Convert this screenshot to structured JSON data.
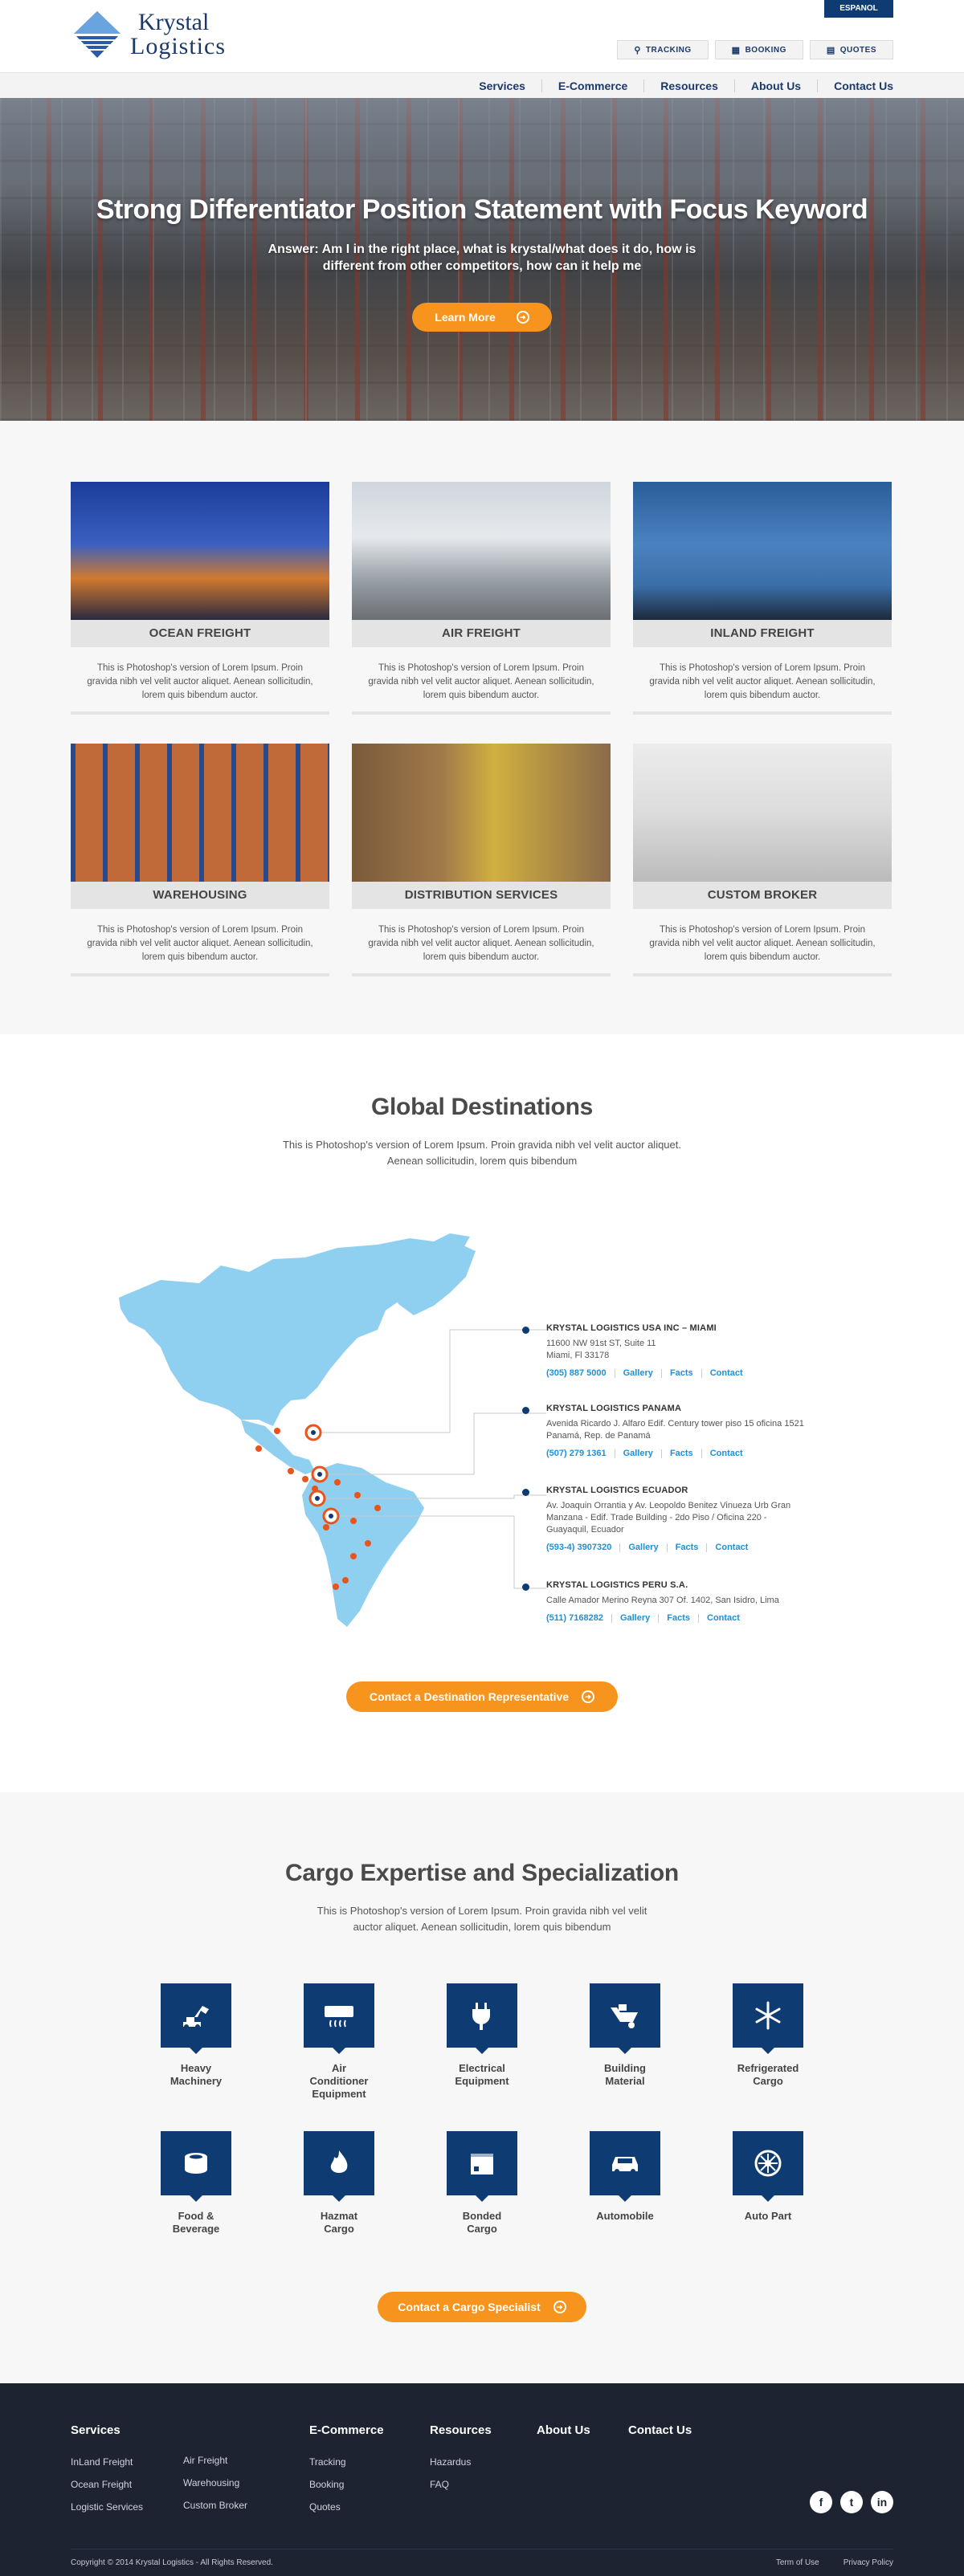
{
  "header": {
    "logo_line1": "Krystal",
    "logo_line2": "Logistics",
    "language_button": "ESPANOL",
    "utility_links": [
      {
        "label": "TRACKING",
        "icon": "map-pin-icon"
      },
      {
        "label": "BOOKING",
        "icon": "calendar-icon"
      },
      {
        "label": "QUOTES",
        "icon": "chat-bubble-icon"
      }
    ],
    "nav": [
      "Services",
      "E-Commerce",
      "Resources",
      "About Us",
      "Contact Us"
    ]
  },
  "hero": {
    "title": "Strong Differentiator Position Statement with Focus Keyword",
    "subtitle_prefix": "Answer:",
    "subtitle": "Am I in the right place, what is krystal/what does it do, how is different from other competitors, how can it help me",
    "button": "Learn More"
  },
  "services": [
    {
      "title": "OCEAN FREIGHT",
      "desc": "This is Photoshop's version of Lorem Ipsum. Proin gravida nibh vel velit auctor aliquet. Aenean sollicitudin, lorem quis bibendum auctor."
    },
    {
      "title": "AIR FREIGHT",
      "desc": "This is Photoshop's version of Lorem Ipsum. Proin gravida nibh vel velit auctor aliquet. Aenean sollicitudin, lorem quis bibendum auctor."
    },
    {
      "title": "INLAND FREIGHT",
      "desc": "This is Photoshop's version of Lorem Ipsum. Proin gravida nibh vel velit auctor aliquet. Aenean sollicitudin, lorem quis bibendum auctor."
    },
    {
      "title": "WAREHOUSING",
      "desc": "This is Photoshop's version of Lorem Ipsum. Proin gravida nibh vel velit auctor aliquet. Aenean sollicitudin, lorem quis bibendum auctor."
    },
    {
      "title": "DISTRIBUTION SERVICES",
      "desc": "This is Photoshop's version of Lorem Ipsum. Proin gravida nibh vel velit auctor aliquet. Aenean sollicitudin, lorem quis bibendum auctor."
    },
    {
      "title": "CUSTOM BROKER",
      "desc": "This is Photoshop's version of Lorem Ipsum. Proin gravida nibh vel velit auctor aliquet. Aenean sollicitudin, lorem quis bibendum auctor."
    }
  ],
  "global": {
    "title": "Global Destinations",
    "desc_line1": "This is Photoshop's version  of Lorem Ipsum. Proin gravida nibh vel velit auctor aliquet.",
    "desc_line2": "Aenean sollicitudin, lorem quis bibendum",
    "offices": [
      {
        "name": "KRYSTAL LOGISTICS USA INC – MIAMI",
        "address": [
          "11600 NW 91st ST, Suite 11",
          "Miami, Fl 33178"
        ],
        "phone": "(305) 887 5000",
        "links": [
          "Gallery",
          "Facts",
          "Contact"
        ]
      },
      {
        "name": "KRYSTAL LOGISTICS PANAMA",
        "address": [
          "Avenida Ricardo J. Alfaro Edif. Century tower piso 15 oficina 1521",
          "Panamá, Rep. de Panamá"
        ],
        "phone": "(507) 279 1361",
        "links": [
          "Gallery",
          "Facts",
          "Contact"
        ]
      },
      {
        "name": "KRYSTAL LOGISTICS ECUADOR",
        "address": [
          "Av. Joaquin Orrantia y Av. Leopoldo Benitez Vinueza Urb Gran",
          "Manzana - Edif. Trade Building - 2do Piso / Oficina 220 -",
          "Guayaquil, Ecuador"
        ],
        "phone": "(593-4) 3907320",
        "links": [
          "Gallery",
          "Facts",
          "Contact"
        ]
      },
      {
        "name": "KRYSTAL LOGISTICS PERU S.A.",
        "address": [
          "Calle Amador Merino Reyna 307 Of. 1402, San Isidro, Lima"
        ],
        "phone": "(511) 7168282",
        "links": [
          "Gallery",
          "Facts",
          "Contact"
        ]
      }
    ],
    "button": "Contact a Destination Representative"
  },
  "cargo": {
    "title": "Cargo Expertise and Specialization",
    "desc_line1": "This is Photoshop's version  of Lorem Ipsum. Proin gravida nibh vel velit",
    "desc_line2": "auctor aliquet. Aenean sollicitudin, lorem quis bibendum",
    "items": [
      {
        "label1": "Heavy",
        "label2": "Machinery",
        "icon": "excavator-icon"
      },
      {
        "label1": "Air Conditioner",
        "label2": "Equipment",
        "icon": "air-conditioner-icon"
      },
      {
        "label1": "Electrical",
        "label2": "Equipment",
        "icon": "plug-icon"
      },
      {
        "label1": "Building",
        "label2": "Material",
        "icon": "wheelbarrow-icon"
      },
      {
        "label1": "Refrigerated",
        "label2": "Cargo",
        "icon": "snowflake-icon"
      },
      {
        "label1": "Food &",
        "label2": "Beverage",
        "icon": "can-icon"
      },
      {
        "label1": "Hazmat",
        "label2": "Cargo",
        "icon": "flame-icon"
      },
      {
        "label1": "Bonded",
        "label2": "Cargo",
        "icon": "box-icon"
      },
      {
        "label1": "Automobile",
        "label2": "",
        "icon": "car-icon"
      },
      {
        "label1": "Auto Part",
        "label2": "",
        "icon": "wheel-icon"
      }
    ],
    "button": "Contact a Cargo Specialist"
  },
  "footer": {
    "services_head": "Services",
    "services_col1": [
      "InLand Freight",
      "Ocean Freight",
      "Logistic Services"
    ],
    "services_col2": [
      "Air Freight",
      "Warehousing",
      "Custom Broker"
    ],
    "ecommerce_head": "E-Commerce",
    "ecommerce_links": [
      "Tracking",
      "Booking",
      "Quotes"
    ],
    "resources_head": "Resources",
    "resources_links": [
      "Hazardus",
      "FAQ"
    ],
    "about_head": "About Us",
    "contact_head": "Contact Us",
    "social": [
      "f",
      "t",
      "in"
    ],
    "copyright": "Copyright © 2014 Krystal Logistics - All Rights Reserved.",
    "legal": [
      "Term of Use",
      "Privacy Policy"
    ]
  },
  "colors": {
    "navy": "#0d3b72",
    "orange": "#f7941d",
    "map_blue": "#8fd0f0",
    "link_blue": "#1e90d6",
    "footer_bg": "#1d2331"
  }
}
